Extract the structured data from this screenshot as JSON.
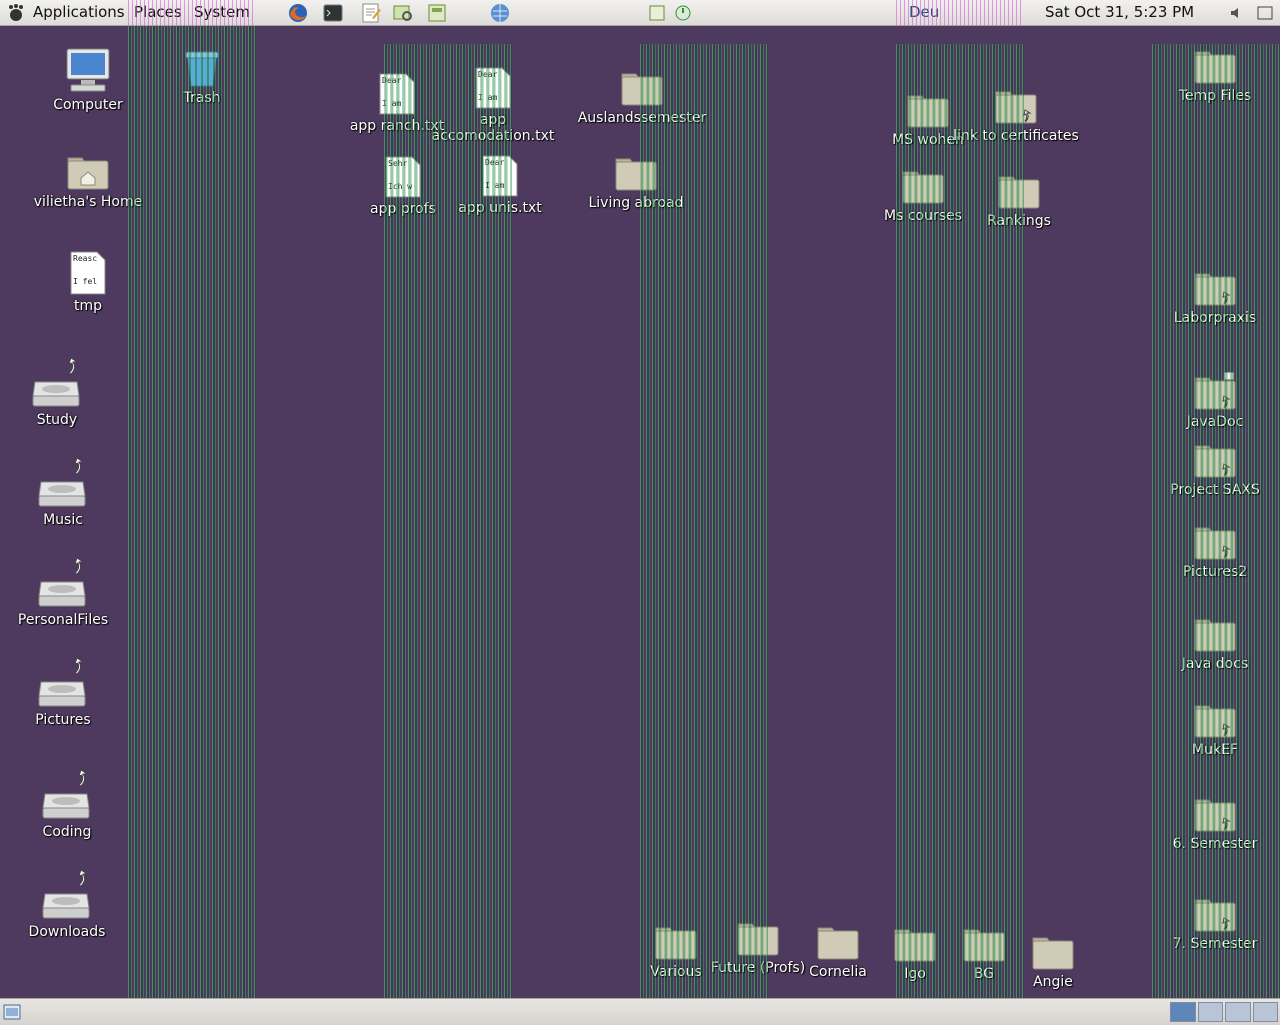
{
  "top_panel": {
    "menus": [
      "Applications",
      "Places",
      "System"
    ],
    "keyboard_layout": "Deu",
    "clock": "Sat Oct 31,  5:23 PM",
    "launchers": [
      "firefox-icon",
      "terminal-icon",
      "text-editor-icon",
      "image-viewer-icon",
      "file-manager-icon",
      "network-icon"
    ],
    "tray": [
      "sticky-notes-icon",
      "power-icon",
      "volume-icon",
      "window-icon"
    ]
  },
  "desktop": {
    "left_column": [
      {
        "label": "Computer",
        "icon": "computer-icon"
      },
      {
        "label": "vilietha's Home",
        "icon": "home-folder-icon"
      },
      {
        "label": "tmp",
        "icon": "text-file-icon",
        "preview": [
          "Reasc",
          "I fel"
        ]
      },
      {
        "label": "Study",
        "icon": "drive-link-icon"
      },
      {
        "label": "Music",
        "icon": "drive-link-icon"
      },
      {
        "label": "PersonalFiles",
        "icon": "drive-link-icon"
      },
      {
        "label": "Pictures",
        "icon": "drive-link-icon"
      },
      {
        "label": "Coding",
        "icon": "drive-link-icon"
      },
      {
        "label": "Downloads",
        "icon": "drive-link-icon"
      }
    ],
    "trash": {
      "label": "Trash"
    },
    "text_files": [
      {
        "label": "app ranch.txt",
        "preview": [
          "Dear",
          "I am"
        ]
      },
      {
        "label": "app accomodation.txt",
        "label_line1": "app",
        "label_line2": "accomodation.txt",
        "preview": [
          "Dear",
          "I am"
        ]
      },
      {
        "label": "app profs",
        "preview": [
          "Sehr",
          "Ich w"
        ]
      },
      {
        "label": "app unis.txt",
        "preview": [
          "Dear",
          "I am"
        ]
      }
    ],
    "middle_folders": [
      {
        "label": "Auslandssemester"
      },
      {
        "label": "Living abroad"
      }
    ],
    "center_folders": [
      {
        "label": "MS wohen"
      },
      {
        "label": "link to certificates"
      },
      {
        "label": "Ms courses"
      },
      {
        "label": "Rankings"
      }
    ],
    "right_column": [
      {
        "label": "Temp Files"
      },
      {
        "label": "Laborpraxis"
      },
      {
        "label": "JavaDoc"
      },
      {
        "label": "Project SAXS"
      },
      {
        "label": "Pictures2"
      },
      {
        "label": "Java docs"
      },
      {
        "label": "MukEF"
      },
      {
        "label": "6. Semester"
      },
      {
        "label": "7. Semester"
      }
    ],
    "bottom_row": [
      {
        "label": "Various"
      },
      {
        "label": "Future (Profs)"
      },
      {
        "label": "Cornelia"
      },
      {
        "label": "Igo"
      },
      {
        "label": "BG"
      },
      {
        "label": "Angie"
      }
    ]
  },
  "bottom_panel": {
    "workspaces": 4,
    "active_workspace": 1
  },
  "colors": {
    "desktop_bg": "#4e3a5e",
    "glitch_green": "#3bd46a",
    "glitch_magenta": "#d25bd8"
  }
}
